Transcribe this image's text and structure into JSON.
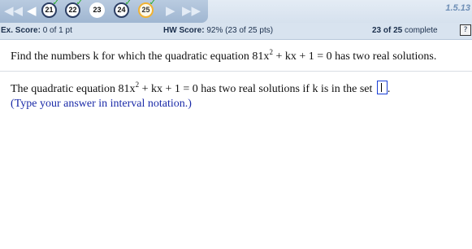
{
  "nav": {
    "first_icon": "first-question-icon",
    "prev_icon": "previous-question-icon",
    "next_icon": "next-question-icon",
    "last_icon": "last-question-icon",
    "first_glyph": "◀◀",
    "prev_glyph": "◀",
    "next_glyph": "▶",
    "last_glyph": "▶▶",
    "questions": [
      {
        "label": "21",
        "checked": true
      },
      {
        "label": "22",
        "checked": true
      },
      {
        "label": "23",
        "checked": false,
        "current": true
      },
      {
        "label": "24",
        "checked": true
      },
      {
        "label": "25",
        "checked": true,
        "active": true
      }
    ],
    "check_glyph": "✓",
    "section": "1.5.13"
  },
  "scores": {
    "ex_label": "Ex. Score:",
    "ex_value": "0 of 1 pt",
    "hw_label": "HW Score:",
    "hw_value": "92% (23 of 25 pts)",
    "complete_count": "23 of 25",
    "complete_text": "complete",
    "help_glyph": "?"
  },
  "question": {
    "prompt_a": "Find the numbers k for which the quadratic equation 81x",
    "exp": "2",
    "prompt_b": " + kx + 1 = 0 has two real solutions.",
    "answer_a": "The quadratic equation 81x",
    "answer_exp": "2",
    "answer_b": " + kx + 1 = 0 has two real solutions if k is in the set ",
    "answer_value": "",
    "answer_end": ".",
    "hint": "(Type your answer in interval notation.)"
  },
  "colors": {
    "nav_tab": "#9fb6d1",
    "score_bar": "#d8e3ef",
    "hint_text": "#1a2aa8",
    "check": "#22aa22",
    "active_ring": "#f0b233"
  }
}
